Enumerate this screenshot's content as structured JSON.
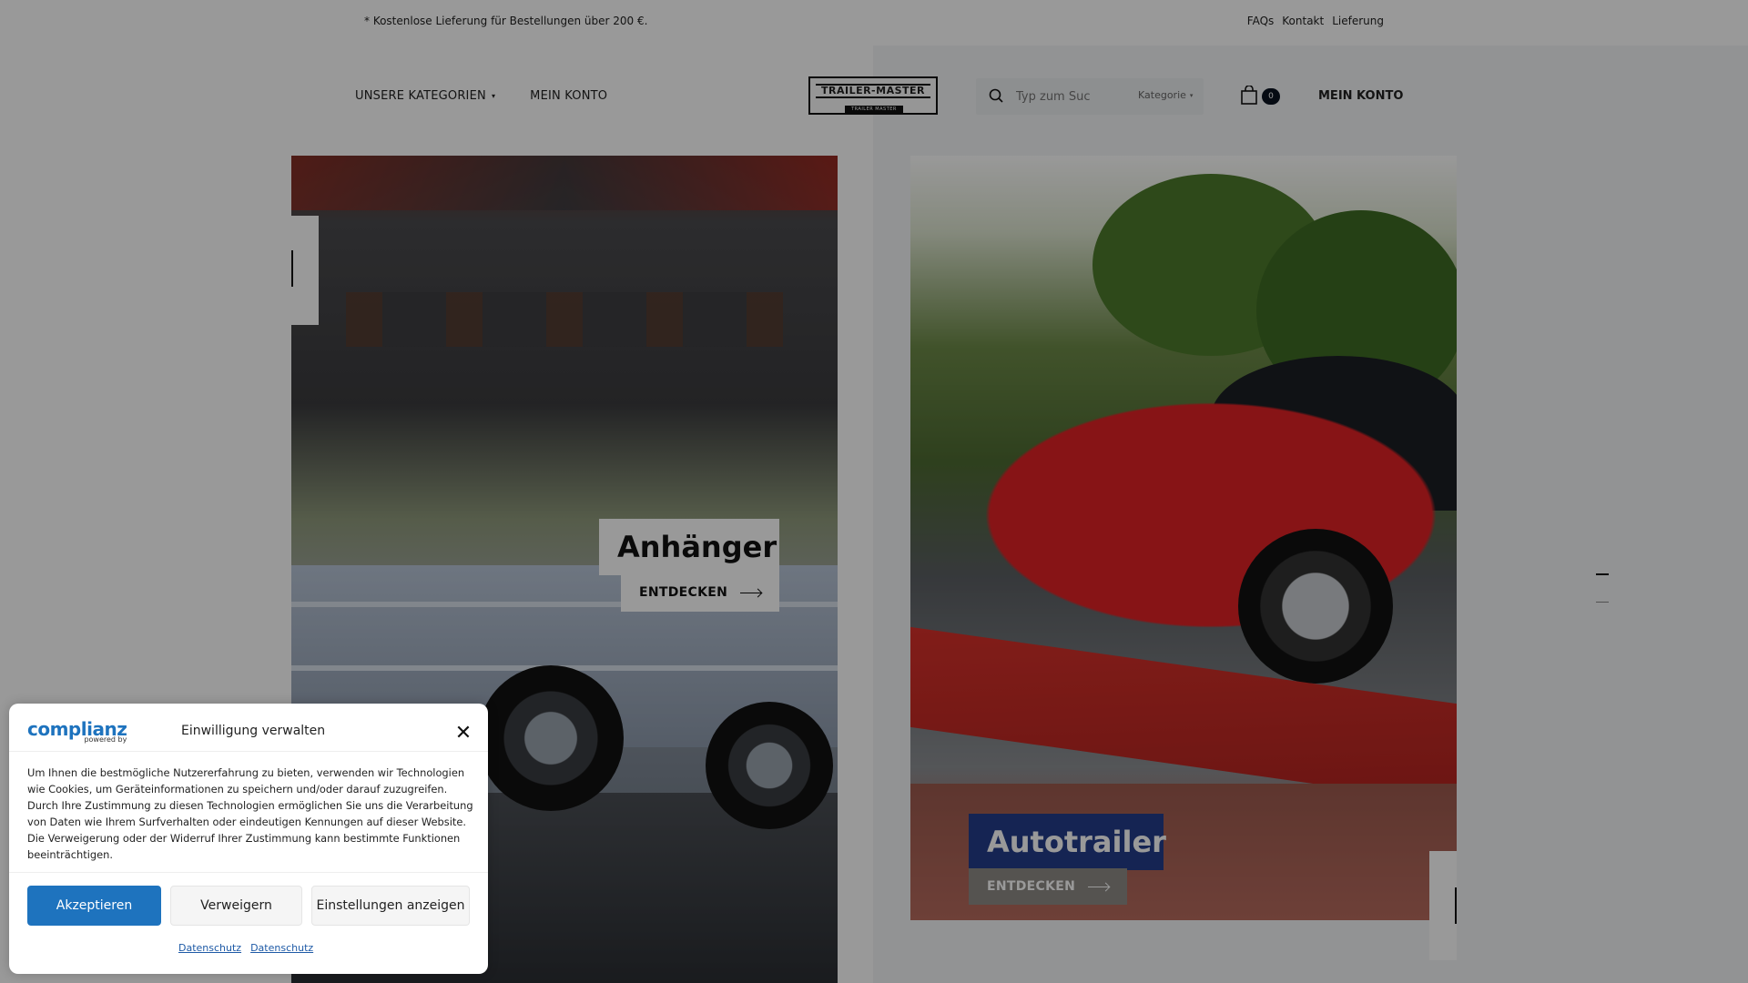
{
  "topbar": {
    "promo": "* Kostenlose Lieferung für Bestellungen über 200 €.",
    "links": [
      "FAQs",
      "Kontakt",
      "Lieferung"
    ]
  },
  "header": {
    "nav": {
      "categories": "UNSERE KATEGORIEN",
      "account": "MEIN KONTO"
    },
    "logo": {
      "main": "TRAILER-MASTER",
      "sub": "TRAILER MASTER"
    },
    "search": {
      "placeholder": "Typ zum Suc",
      "category": "Kategorie"
    },
    "cart_count": "0",
    "account_right": "MEIN KONTO"
  },
  "hero": {
    "left": {
      "title": "Anhänger",
      "cta": "ENTDECKEN"
    },
    "right": {
      "title": "Autotrailer",
      "cta": "ENTDECKEN"
    }
  },
  "cookie": {
    "brand": "complianz",
    "brand_sub": "powered by",
    "title": "Einwilligung verwalten",
    "message": "Um Ihnen die bestmögliche Nutzererfahrung zu bieten, verwenden wir Technologien wie Cookies, um Geräteinformationen zu speichern und/oder darauf zuzugreifen. Durch Ihre Zustimmung zu diesen Technologien ermöglichen Sie uns die Verarbeitung von Daten wie Ihrem Surfverhalten oder eindeutigen Kennungen auf dieser Website. Die Verweigerung oder der Widerruf Ihrer Zustimmung kann bestimmte Funktionen beeinträchtigen.",
    "accept": "Akzeptieren",
    "deny": "Verweigern",
    "settings": "Einstellungen anzeigen",
    "links": [
      "Datenschutz",
      "Datenschutz"
    ]
  },
  "colors": {
    "accent": "#1e73be",
    "dark": "#0b1320"
  }
}
